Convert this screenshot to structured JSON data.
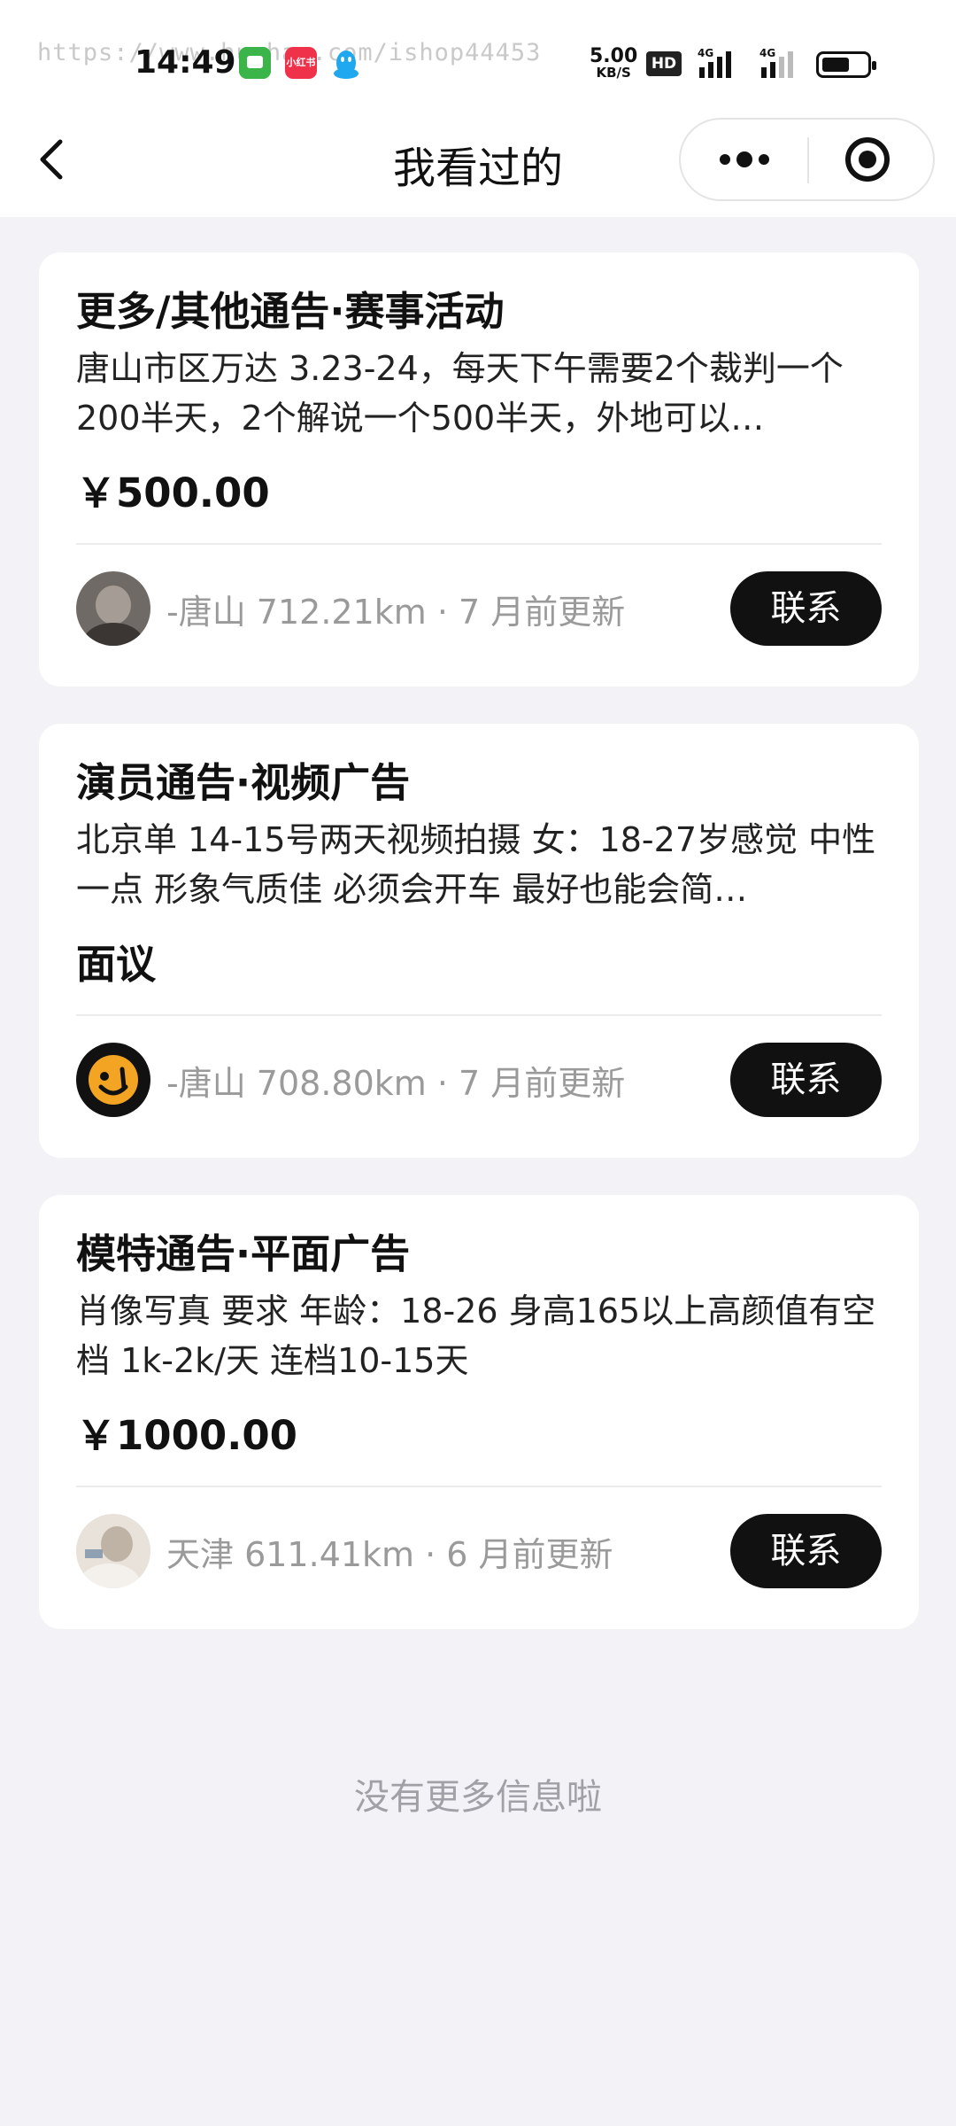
{
  "status_bar": {
    "time": "14:49",
    "watermark": "https://www.huzhan.com/ishop44453",
    "app_badge": "小红书",
    "net_speed_value": "5.00",
    "net_speed_unit": "KB/S",
    "hd_label": "HD",
    "signal_1": "4G",
    "signal_2": "4G",
    "battery_level": 0.6
  },
  "nav": {
    "title": "我看过的"
  },
  "cards": [
    {
      "title": "更多/其他通告·赛事活动",
      "description": "唐山市区万达 3.23-24，每天下午需要2个裁判一个200半天，2个解说一个500半天，外地可以…",
      "price": "￥500.00",
      "meta": "-唐山 712.21km · 7 月前更新",
      "contact_label": "联系"
    },
    {
      "title": "演员通告·视频广告",
      "description": "北京单 14-15号两天视频拍摄 女：18-27岁感觉 中性一点 形象气质佳 必须会开车 最好也能会简…",
      "price": "面议",
      "meta": "-唐山 708.80km · 7 月前更新",
      "contact_label": "联系"
    },
    {
      "title": "模特通告·平面广告",
      "description": "肖像写真 要求 年龄：18-26 身高165以上高颜值有空档 1k-2k/天 连档10-15天",
      "price": "￥1000.00",
      "meta": "天津 611.41km · 6 月前更新",
      "contact_label": "联系"
    }
  ],
  "footer": {
    "end_text": "没有更多信息啦"
  }
}
